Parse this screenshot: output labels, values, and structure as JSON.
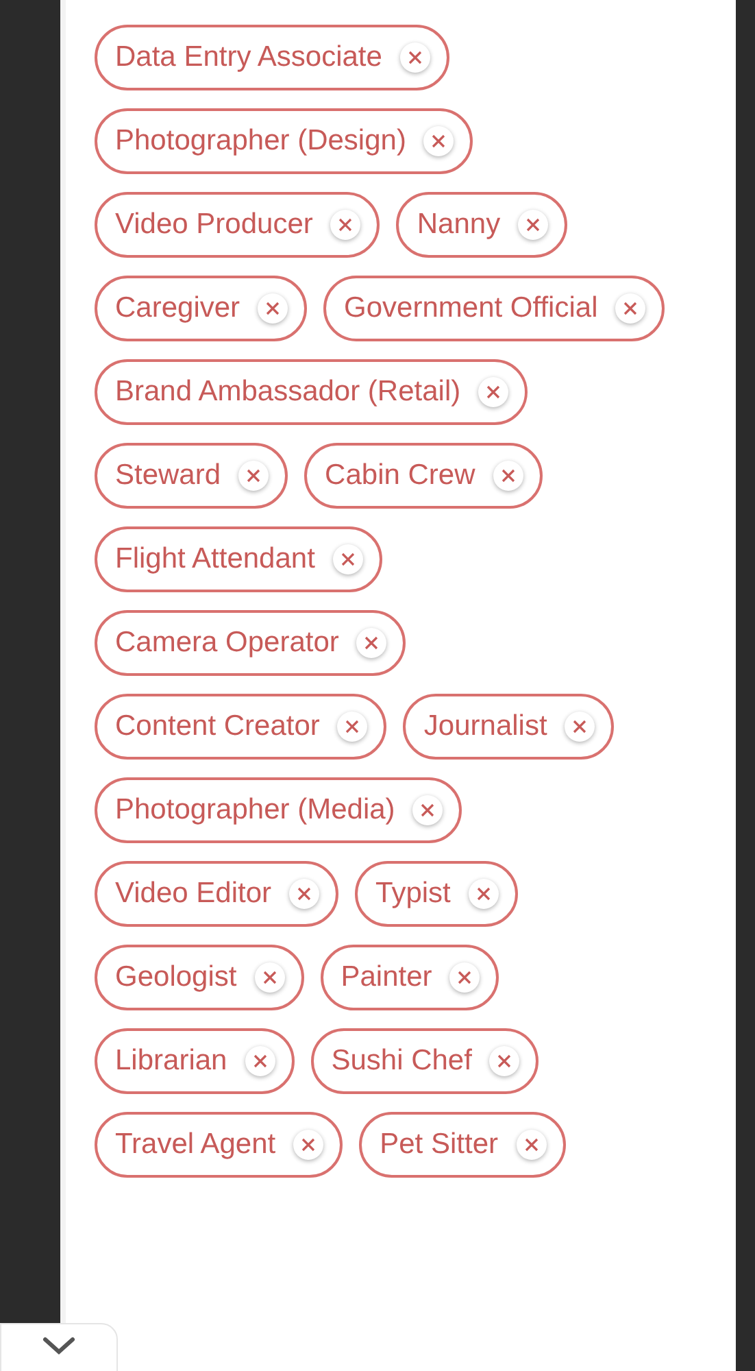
{
  "tags": [
    {
      "label": "Data Entry Associate"
    },
    {
      "label": "Photographer (Design)"
    },
    {
      "label": "Video Producer"
    },
    {
      "label": "Nanny"
    },
    {
      "label": "Caregiver"
    },
    {
      "label": "Government Official"
    },
    {
      "label": "Brand Ambassador (Retail)"
    },
    {
      "label": "Steward"
    },
    {
      "label": "Cabin Crew"
    },
    {
      "label": "Flight Attendant"
    },
    {
      "label": "Camera Operator"
    },
    {
      "label": "Content Creator"
    },
    {
      "label": "Journalist"
    },
    {
      "label": "Photographer (Media)"
    },
    {
      "label": "Video Editor"
    },
    {
      "label": "Typist"
    },
    {
      "label": "Geologist"
    },
    {
      "label": "Painter"
    },
    {
      "label": "Librarian"
    },
    {
      "label": "Sushi Chef"
    },
    {
      "label": "Travel Agent"
    },
    {
      "label": "Pet Sitter"
    }
  ]
}
